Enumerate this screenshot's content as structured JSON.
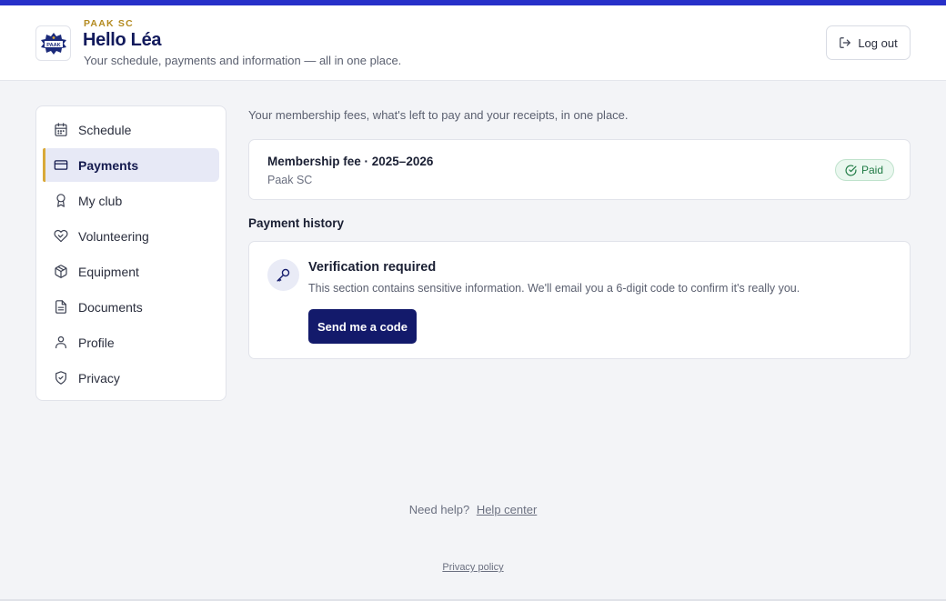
{
  "header": {
    "club_name": "PAAK SC",
    "logo_text": "PAAK",
    "greeting": "Hello Léa",
    "subtitle": "Your schedule, payments and information — all in one place.",
    "logout_label": "Log out"
  },
  "sidebar": {
    "items": [
      {
        "label": "Schedule",
        "icon": "calendar-icon",
        "active": false
      },
      {
        "label": "Payments",
        "icon": "credit-card-icon",
        "active": true
      },
      {
        "label": "My club",
        "icon": "award-ribbon-icon",
        "active": false
      },
      {
        "label": "Volunteering",
        "icon": "heart-hand-icon",
        "active": false
      },
      {
        "label": "Equipment",
        "icon": "package-box-icon",
        "active": false
      },
      {
        "label": "Documents",
        "icon": "document-icon",
        "active": false
      },
      {
        "label": "Profile",
        "icon": "user-icon",
        "active": false
      },
      {
        "label": "Privacy",
        "icon": "shield-check-icon",
        "active": false
      }
    ]
  },
  "main": {
    "intro": "Your membership fees, what's left to pay and your receipts, in one place.",
    "fee": {
      "title": "Membership fee · 2025–2026",
      "club": "Paak SC",
      "status": "Paid",
      "status_icon": "check-circle-icon"
    },
    "history_heading": "Payment history",
    "verification": {
      "icon": "key-icon",
      "title": "Verification required",
      "text": "This section contains sensitive information. We'll email you a 6-digit code to confirm it's really you.",
      "button": "Send me a code"
    }
  },
  "footer": {
    "help_prefix": "Need help?",
    "help_link": "Help center",
    "privacy_link": "Privacy policy"
  },
  "colors": {
    "accent_bar": "#2730c9",
    "primary_navy": "#131a6b",
    "gold": "#b38a1f",
    "active_indicator": "#d9a93a",
    "paid_green": "#1f7a44"
  }
}
